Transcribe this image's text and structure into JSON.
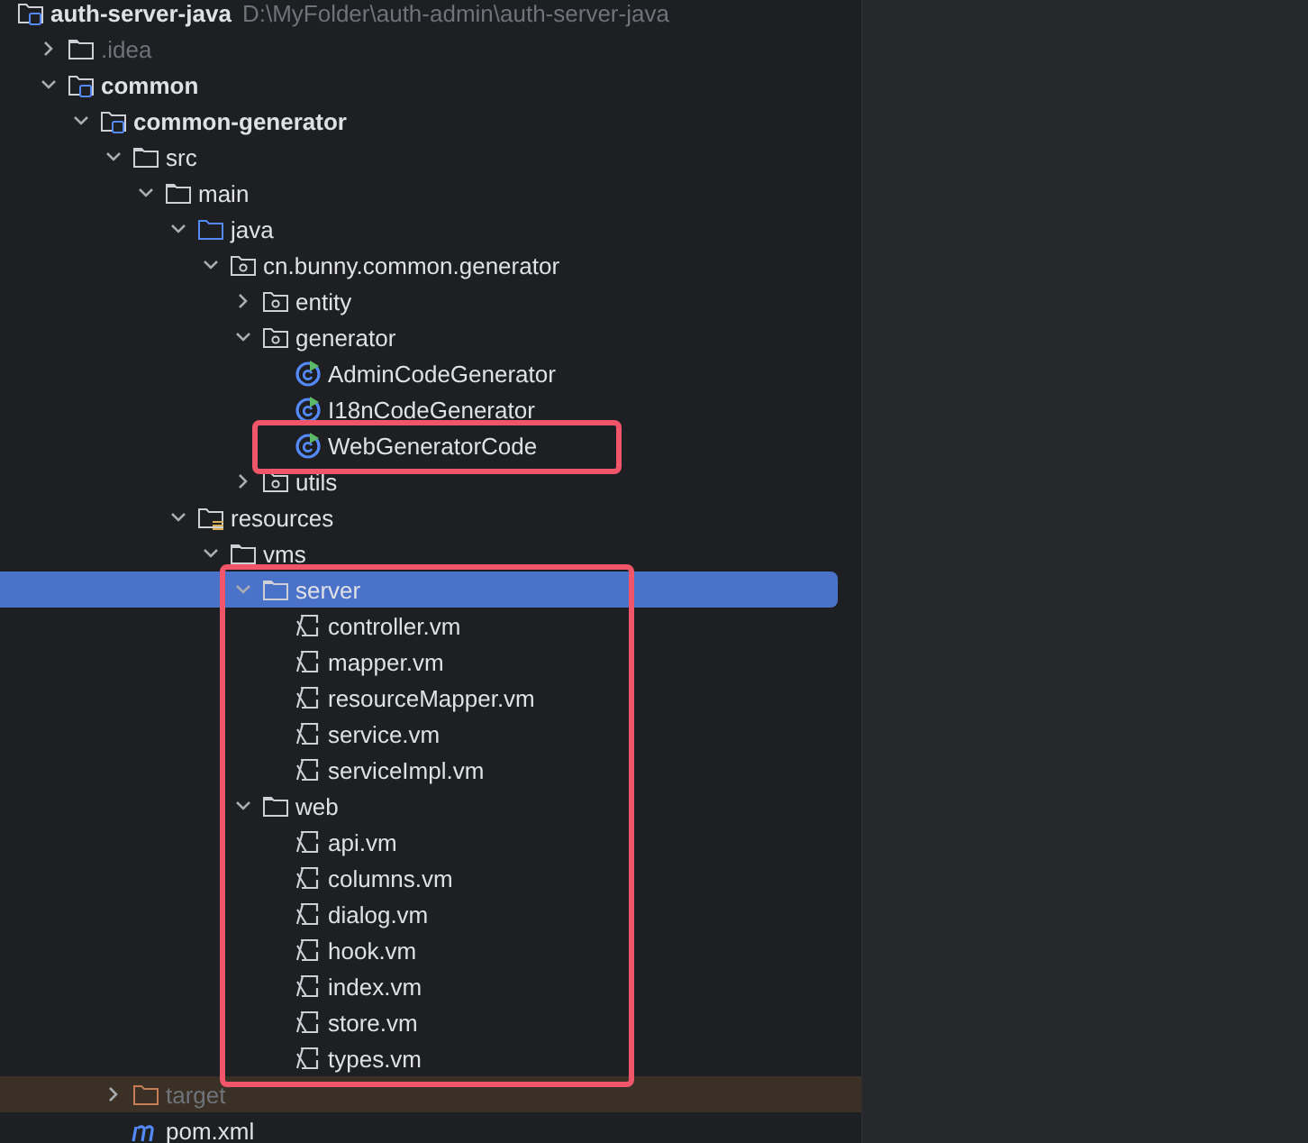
{
  "project": {
    "name": "auth-server-java",
    "path": "D:\\MyFolder\\auth-admin\\auth-server-java"
  },
  "tree": [
    {
      "label": ".idea",
      "kind": "folder",
      "dimmed": true,
      "expanded": false,
      "selected": false
    },
    {
      "label": "common",
      "kind": "module",
      "expanded": true,
      "children": [
        {
          "label": "common-generator",
          "kind": "module",
          "expanded": true,
          "children": [
            {
              "label": "src",
              "kind": "folder",
              "expanded": true,
              "children": [
                {
                  "label": "main",
                  "kind": "folder",
                  "expanded": true,
                  "children": [
                    {
                      "label": "java",
                      "kind": "source-folder",
                      "expanded": true,
                      "children": [
                        {
                          "label": "cn.bunny.common.generator",
                          "kind": "package",
                          "expanded": true,
                          "children": [
                            {
                              "label": "entity",
                              "kind": "package",
                              "expanded": false
                            },
                            {
                              "label": "generator",
                              "kind": "package",
                              "expanded": true,
                              "children": [
                                {
                                  "label": "AdminCodeGenerator",
                                  "kind": "class"
                                },
                                {
                                  "label": "I18nCodeGenerator",
                                  "kind": "class"
                                },
                                {
                                  "label": "WebGeneratorCode",
                                  "kind": "class",
                                  "boxed": true
                                }
                              ]
                            },
                            {
                              "label": "utils",
                              "kind": "package",
                              "expanded": false
                            }
                          ]
                        }
                      ]
                    },
                    {
                      "label": "resources",
                      "kind": "resources-folder",
                      "expanded": true,
                      "children": [
                        {
                          "label": "vms",
                          "kind": "folder",
                          "expanded": true,
                          "children": [
                            {
                              "label": "server",
                              "kind": "folder",
                              "expanded": true,
                              "selected": true,
                              "boxed": true,
                              "children": [
                                {
                                  "label": "controller.vm",
                                  "kind": "template",
                                  "boxed": true
                                },
                                {
                                  "label": "mapper.vm",
                                  "kind": "template",
                                  "boxed": true
                                },
                                {
                                  "label": "resourceMapper.vm",
                                  "kind": "template",
                                  "boxed": true
                                },
                                {
                                  "label": "service.vm",
                                  "kind": "template",
                                  "boxed": true
                                },
                                {
                                  "label": "serviceImpl.vm",
                                  "kind": "template",
                                  "boxed": true
                                }
                              ]
                            },
                            {
                              "label": "web",
                              "kind": "folder",
                              "expanded": true,
                              "boxed": true,
                              "children": [
                                {
                                  "label": "api.vm",
                                  "kind": "template",
                                  "boxed": true
                                },
                                {
                                  "label": "columns.vm",
                                  "kind": "template",
                                  "boxed": true
                                },
                                {
                                  "label": "dialog.vm",
                                  "kind": "template",
                                  "boxed": true
                                },
                                {
                                  "label": "hook.vm",
                                  "kind": "template",
                                  "boxed": true
                                },
                                {
                                  "label": "index.vm",
                                  "kind": "template",
                                  "boxed": true
                                },
                                {
                                  "label": "store.vm",
                                  "kind": "template",
                                  "boxed": true
                                },
                                {
                                  "label": "types.vm",
                                  "kind": "template",
                                  "boxed": true
                                }
                              ]
                            }
                          ]
                        }
                      ]
                    }
                  ]
                }
              ]
            },
            {
              "label": "target",
              "kind": "excluded-folder",
              "dimmed": true,
              "expanded": false,
              "selected": false
            },
            {
              "label": "pom.xml",
              "kind": "maven"
            }
          ]
        }
      ]
    }
  ]
}
